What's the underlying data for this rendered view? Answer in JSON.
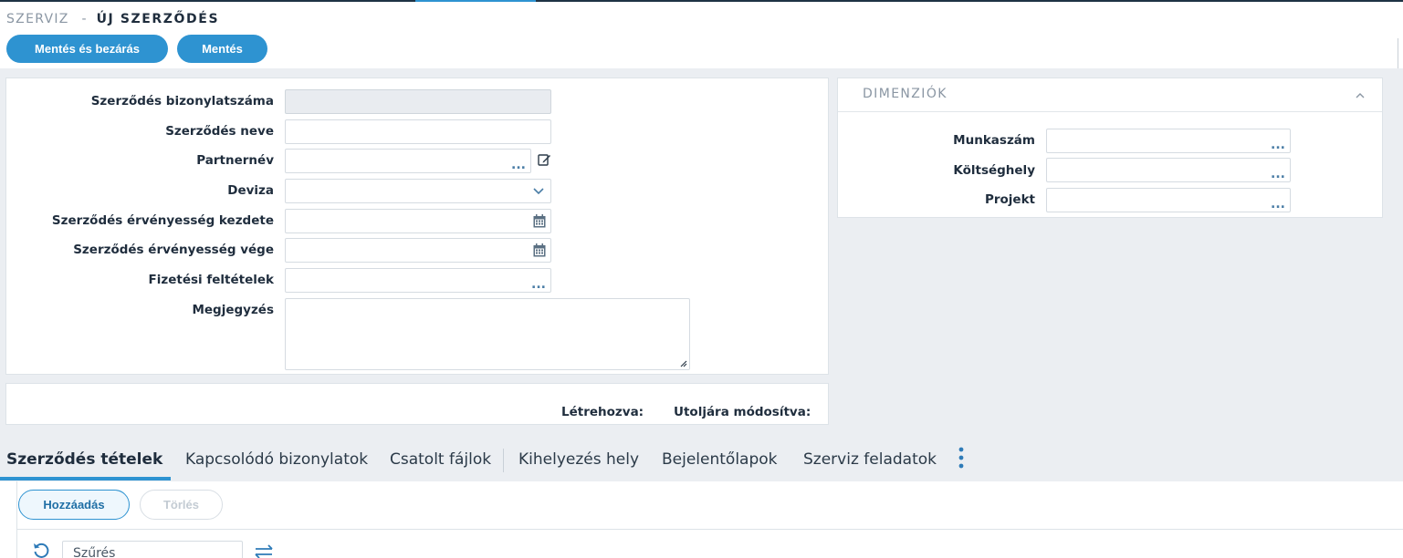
{
  "breadcrumb": {
    "parent": "SZERVIZ",
    "separator": "-",
    "current": "ÚJ SZERZŐDÉS"
  },
  "toolbar": {
    "save_close_label": "Mentés és bezárás",
    "save_label": "Mentés"
  },
  "form": {
    "fields": {
      "contract_number": {
        "label": "Szerződés bizonylatszáma",
        "value": ""
      },
      "contract_name": {
        "label": "Szerződés neve",
        "value": ""
      },
      "partner": {
        "label": "Partnernév",
        "value": ""
      },
      "currency": {
        "label": "Deviza",
        "value": ""
      },
      "valid_from": {
        "label": "Szerződés érvényesség kezdete",
        "value": ""
      },
      "valid_to": {
        "label": "Szerződés érvényesség vége",
        "value": ""
      },
      "payment_terms": {
        "label": "Fizetési feltételek",
        "value": ""
      },
      "note": {
        "label": "Megjegyzés",
        "value": ""
      }
    },
    "dots": "..."
  },
  "dimensions": {
    "title": "DIMENZIÓK",
    "fields": {
      "job_number": {
        "label": "Munkaszám",
        "value": ""
      },
      "cost_center": {
        "label": "Költséghely",
        "value": ""
      },
      "project": {
        "label": "Projekt",
        "value": ""
      }
    }
  },
  "meta": {
    "created_label": "Létrehozva:",
    "modified_label": "Utoljára módosítva:"
  },
  "tabs": [
    {
      "label": "Szerződés tételek",
      "active": true
    },
    {
      "label": "Kapcsolódó bizonylatok",
      "active": false
    },
    {
      "label": "Csatolt fájlok",
      "active": false
    },
    {
      "label": "Kihelyezés hely",
      "active": false
    },
    {
      "label": "Bejelentőlapok",
      "active": false
    },
    {
      "label": "Szerviz feladatok",
      "active": false
    }
  ],
  "items": {
    "add_label": "Hozzáadás",
    "delete_label": "Törlés",
    "filter_placeholder": "Szűrés"
  },
  "colors": {
    "primary": "#2e93d1",
    "background": "#ebeef2",
    "text": "#1f2d3d"
  }
}
